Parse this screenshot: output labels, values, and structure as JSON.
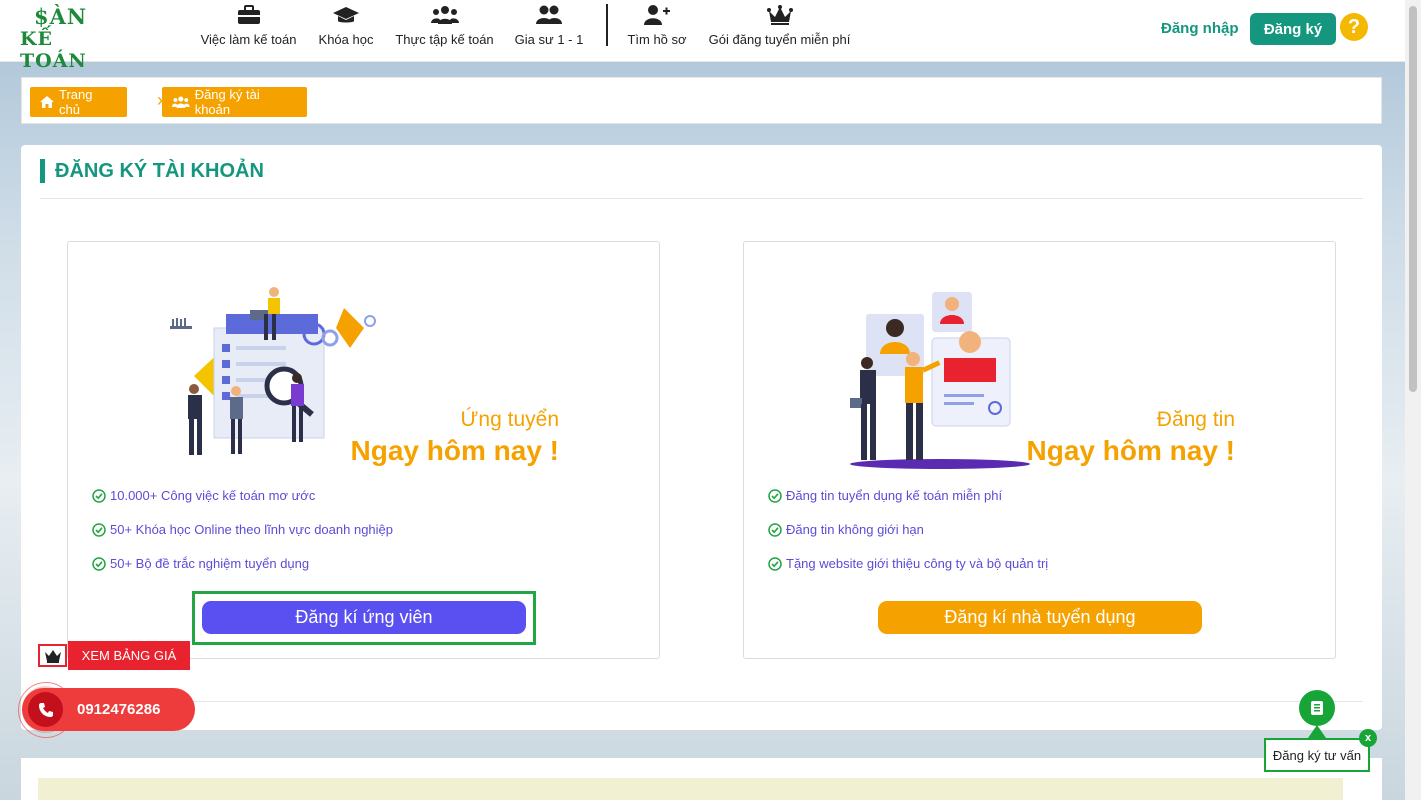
{
  "header": {
    "logo_top": "$ÀN",
    "logo_bottom": "KẾ TOÁN",
    "nav": [
      {
        "label": "Việc làm kế toán",
        "icon": "briefcase-icon"
      },
      {
        "label": "Khóa học",
        "icon": "graduation-cap-icon"
      },
      {
        "label": "Thực tập kế toán",
        "icon": "group-icon"
      },
      {
        "label": "Gia sư 1 - 1",
        "icon": "users-icon"
      },
      {
        "label": "Tìm hồ sơ",
        "icon": "user-plus-icon"
      },
      {
        "label": "Gói đăng tuyển miễn phí",
        "icon": "crown-icon"
      }
    ],
    "login": "Đăng nhập",
    "register": "Đăng ký",
    "help": "?"
  },
  "breadcrumb": {
    "home": "Trang chủ",
    "current": "Đăng ký tài khoản"
  },
  "page": {
    "title": "ĐĂNG KÝ TÀI KHOẢN"
  },
  "candidate_card": {
    "tagline_small": "Ứng tuyển",
    "tagline_big": "Ngay hôm nay !",
    "features": [
      "10.000+ Công việc kế toán mơ ước",
      "50+ Khóa học Online theo lĩnh vực doanh nghiệp",
      "50+ Bộ đề trắc nghiệm tuyển dụng"
    ],
    "button": "Đăng kí ứng viên"
  },
  "employer_card": {
    "tagline_small": "Đăng tin",
    "tagline_big": "Ngay hôm nay !",
    "features": [
      "Đăng tin tuyển dụng kế toán miễn phí",
      "Đăng tin không giới hạn",
      "Tặng website giới thiệu công ty và bộ quản trị"
    ],
    "button": "Đăng kí nhà tuyển dụng"
  },
  "widgets": {
    "price_button": "XEM BẢNG GIÁ",
    "phone": "0912476286",
    "consult": "Đăng ký tư vấn",
    "consult_close": "x"
  },
  "colors": {
    "brand_green": "#14967f",
    "orange": "#f5a200",
    "candidate_button": "#5a4ff0",
    "feature_text": "#5b4cd6",
    "highlight_frame": "#22a542"
  }
}
